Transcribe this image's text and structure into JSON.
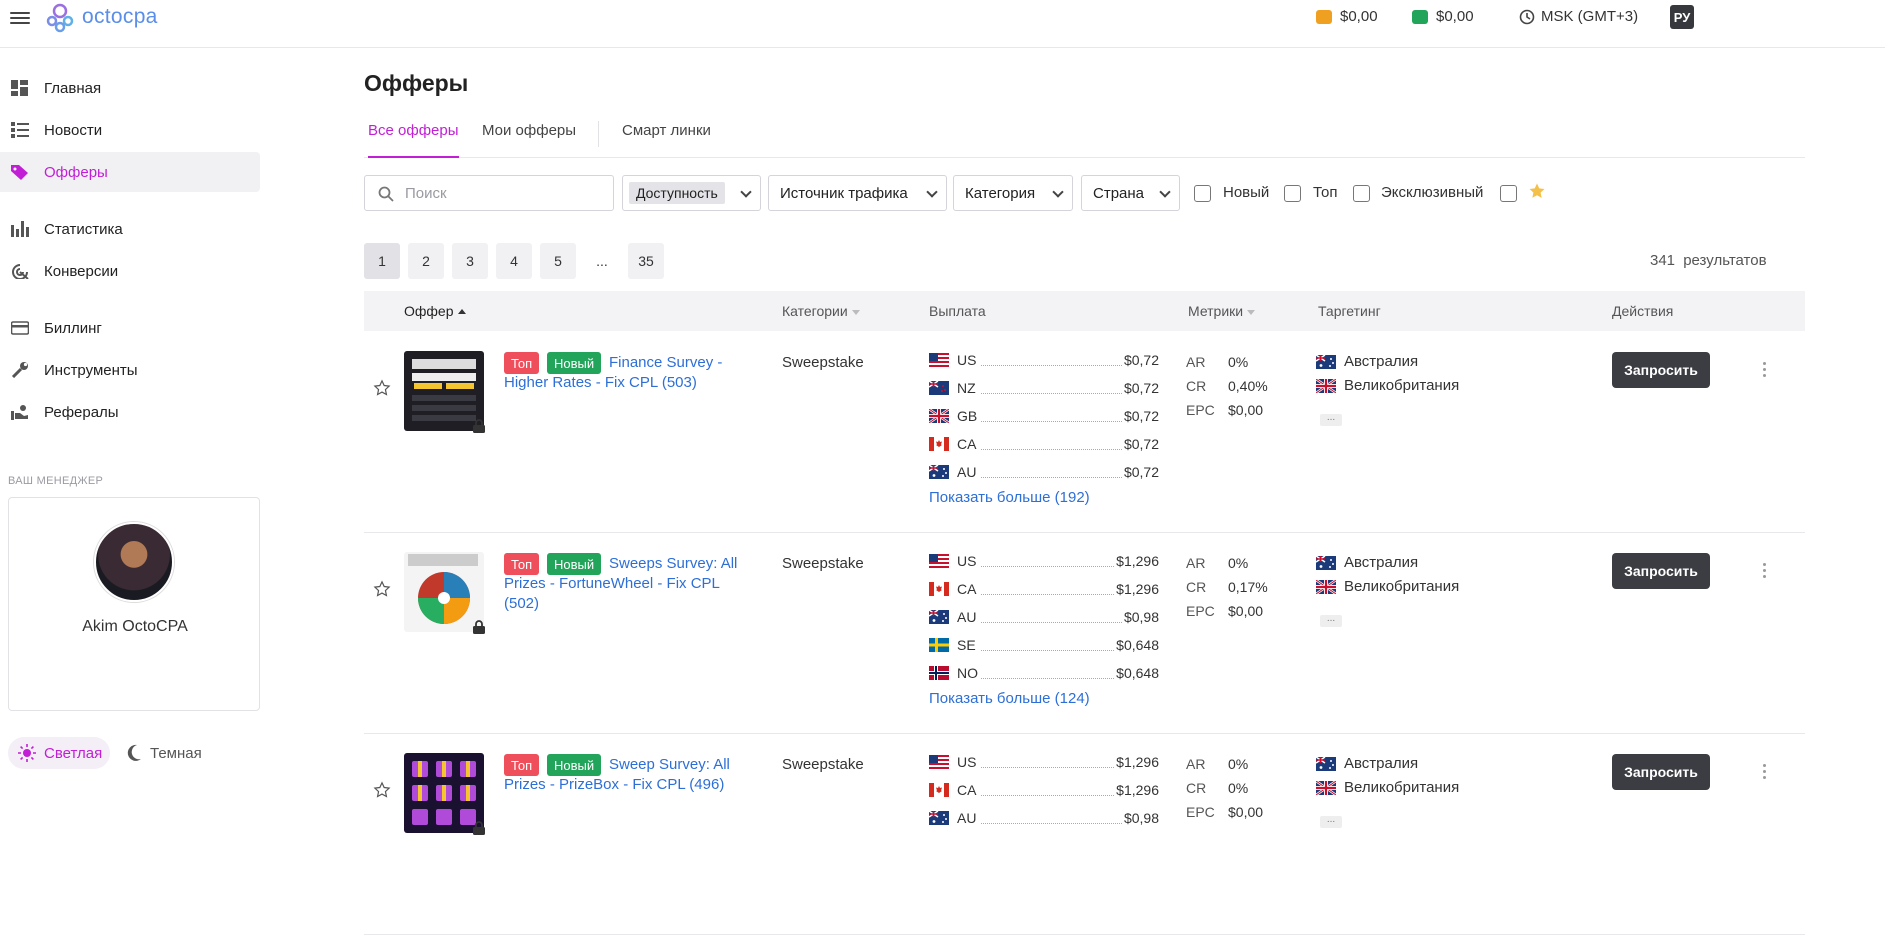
{
  "header": {
    "brand": "octocpa",
    "balance1": "$0,00",
    "balance2": "$0,00",
    "timezone": "MSK (GMT+3)",
    "lang": "РУ"
  },
  "sidebar": {
    "items": [
      {
        "label": "Главная",
        "icon": "dashboard-icon"
      },
      {
        "label": "Новости",
        "icon": "news-icon"
      },
      {
        "label": "Офферы",
        "icon": "tag-icon",
        "active": true
      },
      {
        "label": "Статистика",
        "icon": "bar-chart-icon"
      },
      {
        "label": "Конверсии",
        "icon": "conversions-icon"
      },
      {
        "label": "Биллинг",
        "icon": "card-icon"
      },
      {
        "label": "Инструменты",
        "icon": "wrench-icon"
      },
      {
        "label": "Рефералы",
        "icon": "referrals-icon"
      }
    ],
    "manager_caption": "ВАШ МЕНЕДЖЕР",
    "manager_name": "Akim OctoCPA",
    "theme_light": "Светлая",
    "theme_dark": "Темная"
  },
  "page": {
    "title": "Офферы",
    "tabs": [
      "Все офферы",
      "Мои офферы",
      "Смарт линки"
    ]
  },
  "filters": {
    "search_placeholder": "Поиск",
    "availability": "Доступность",
    "traffic_source": "Источник трафика",
    "category": "Категория",
    "country": "Страна",
    "checkboxes": [
      "Новый",
      "Топ",
      "Эксклюзивный"
    ]
  },
  "pagination": {
    "pages": [
      "1",
      "2",
      "3",
      "4",
      "5",
      "...",
      "35"
    ],
    "current": "1",
    "results_count": "341",
    "results_label": "результатов"
  },
  "table": {
    "headers": [
      "Оффер",
      "Категории",
      "Выплата",
      "Метрики",
      "Таргетинг",
      "Действия"
    ],
    "rows": [
      {
        "badges": [
          "Топ",
          "Новый"
        ],
        "title": "Finance Survey - Higher Rates - Fix CPL (503)",
        "category": "Sweepstake",
        "payouts": [
          {
            "cc": "US",
            "amount": "$0,72"
          },
          {
            "cc": "NZ",
            "amount": "$0,72"
          },
          {
            "cc": "GB",
            "amount": "$0,72"
          },
          {
            "cc": "CA",
            "amount": "$0,72"
          },
          {
            "cc": "AU",
            "amount": "$0,72"
          }
        ],
        "more": "Показать больше (192)",
        "metrics": {
          "AR": "0%",
          "CR": "0,40%",
          "EPC": "$0,00"
        },
        "targeting": [
          "Австралия",
          "Великобритания"
        ],
        "action": "Запросить"
      },
      {
        "badges": [
          "Топ",
          "Новый"
        ],
        "title": "Sweeps Survey: All Prizes - FortuneWheel - Fix CPL (502)",
        "category": "Sweepstake",
        "payouts": [
          {
            "cc": "US",
            "amount": "$1,296"
          },
          {
            "cc": "CA",
            "amount": "$1,296"
          },
          {
            "cc": "AU",
            "amount": "$0,98"
          },
          {
            "cc": "SE",
            "amount": "$0,648"
          },
          {
            "cc": "NO",
            "amount": "$0,648"
          }
        ],
        "more": "Показать больше (124)",
        "metrics": {
          "AR": "0%",
          "CR": "0,17%",
          "EPC": "$0,00"
        },
        "targeting": [
          "Австралия",
          "Великобритания"
        ],
        "action": "Запросить"
      },
      {
        "badges": [
          "Топ",
          "Новый"
        ],
        "title": "Sweep Survey: All Prizes - PrizeBox - Fix CPL (496)",
        "category": "Sweepstake",
        "payouts": [
          {
            "cc": "US",
            "amount": "$1,296"
          },
          {
            "cc": "CA",
            "amount": "$1,296"
          },
          {
            "cc": "AU",
            "amount": "$0,98"
          }
        ],
        "metrics": {
          "AR": "0%",
          "CR": "0%",
          "EPC": "$0,00"
        },
        "targeting": [
          "Австралия",
          "Великобритания"
        ],
        "action": "Запросить"
      }
    ]
  },
  "colors": {
    "accent": "#c21ed6",
    "link": "#2d6fd6",
    "top_badge": "#ef4f5a",
    "new_badge": "#22a45a",
    "button": "#3b3d43"
  }
}
